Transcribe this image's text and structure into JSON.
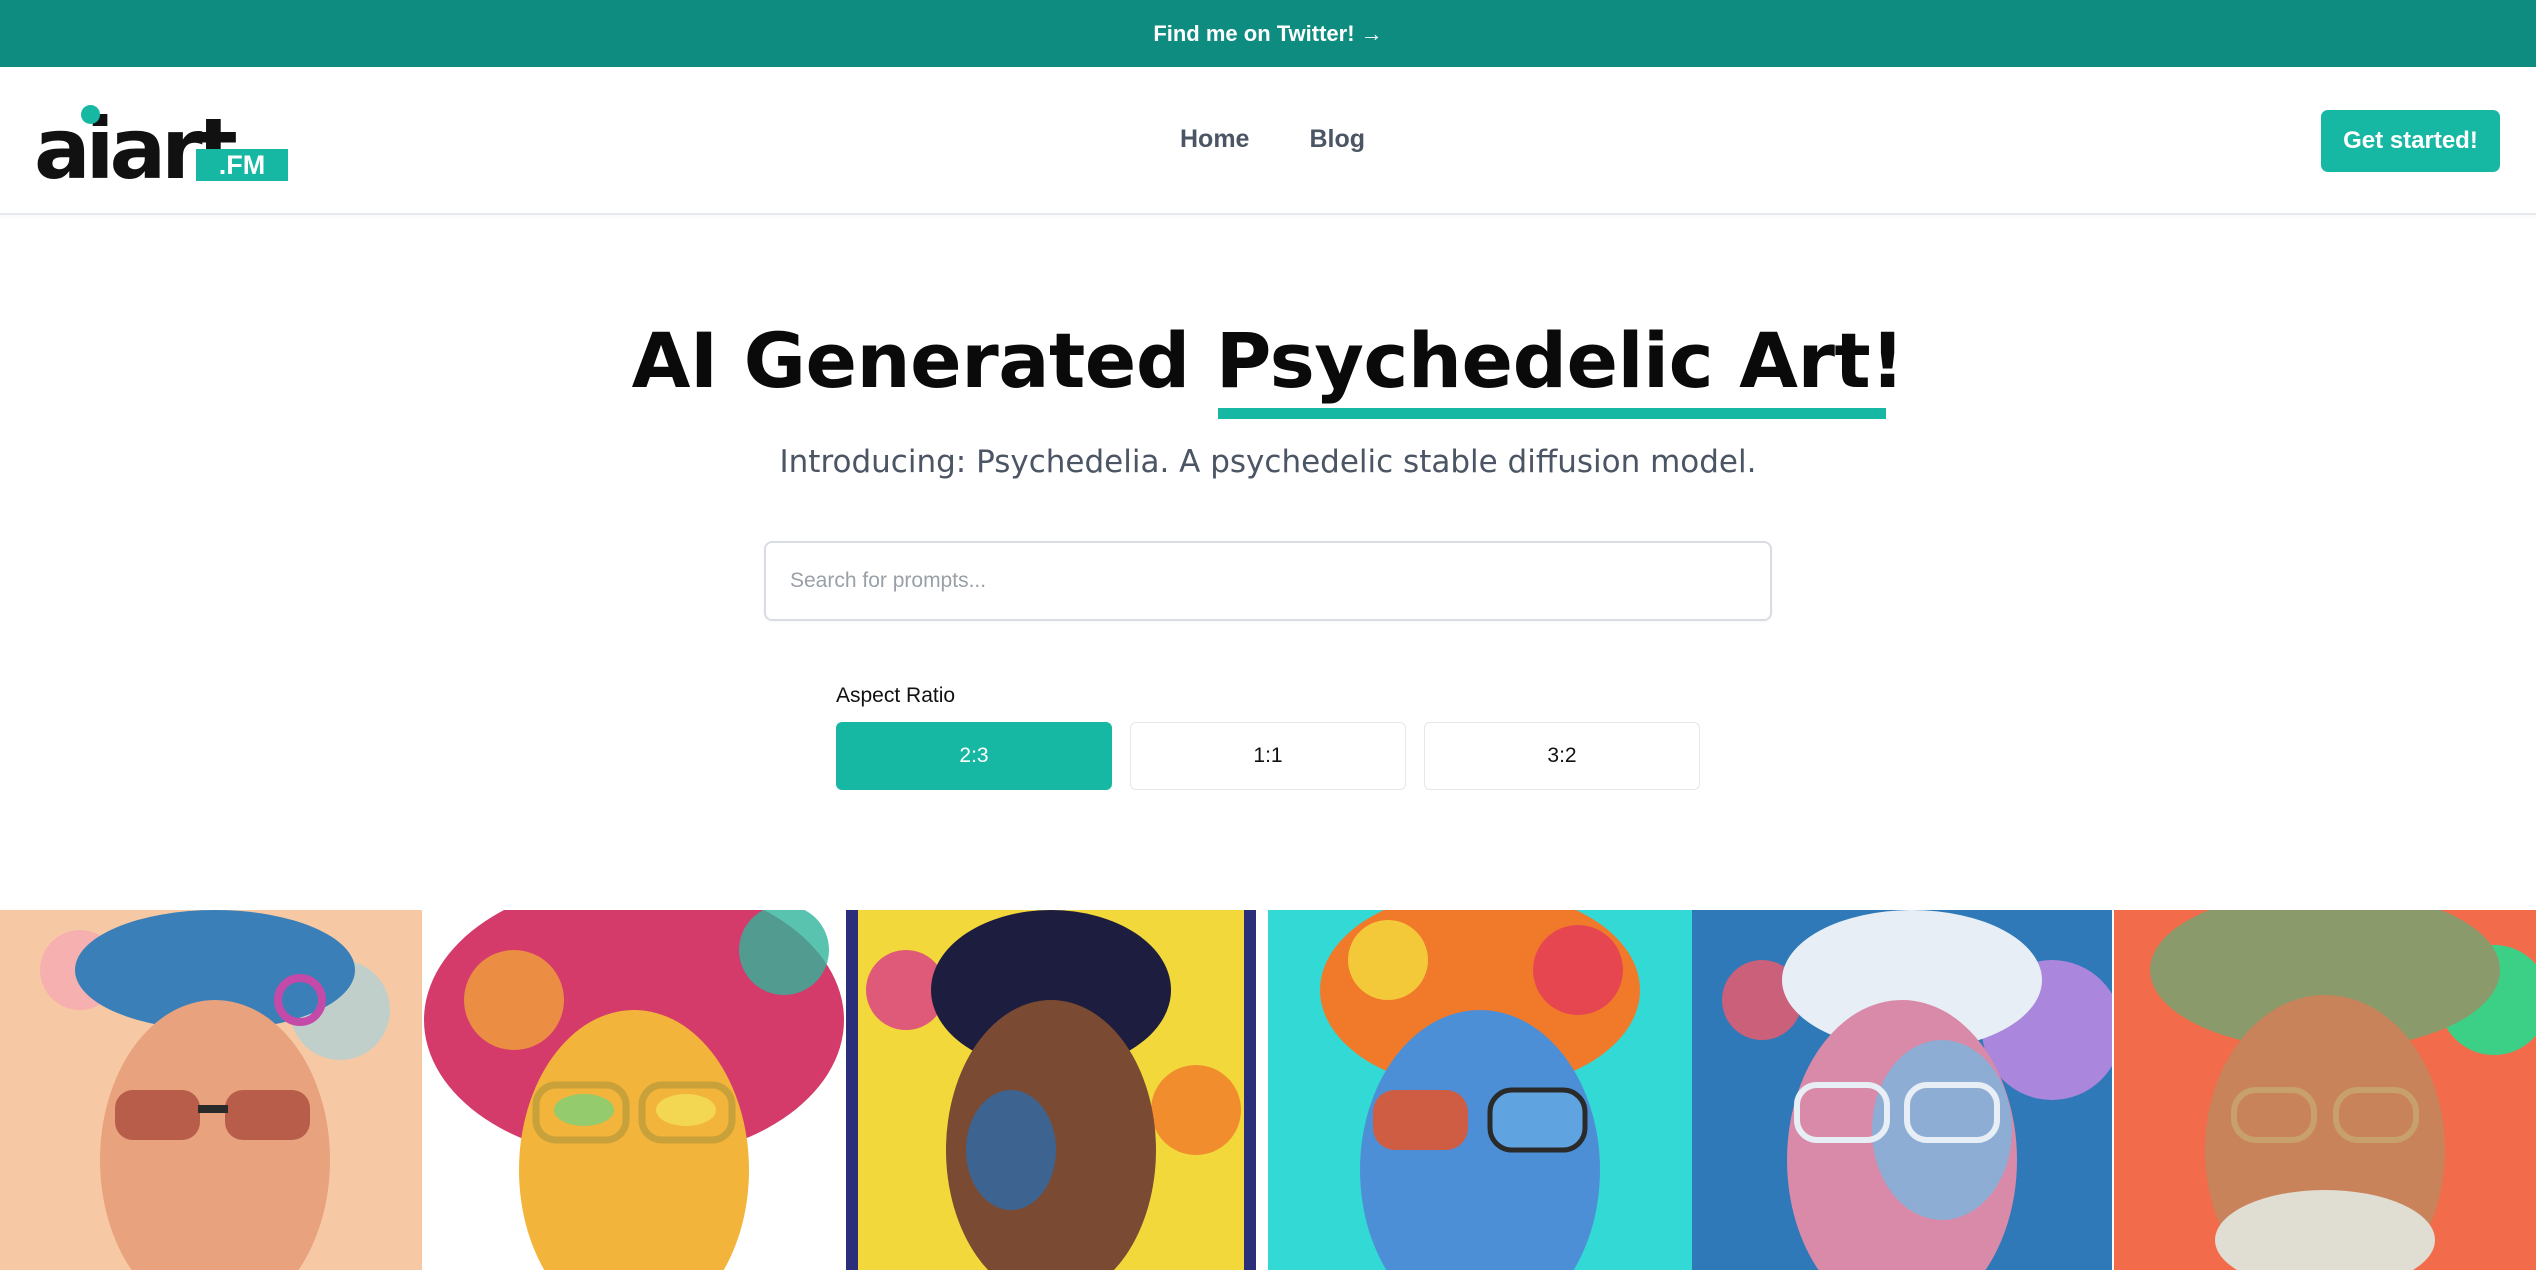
{
  "announcement": {
    "text": "Find me on Twitter! →"
  },
  "logo": {
    "word": "aiart",
    "suffix": ".FM"
  },
  "nav": {
    "links": [
      "Home",
      "Blog"
    ],
    "cta": "Get started!"
  },
  "hero": {
    "title_prefix": "AI Generated ",
    "title_highlight": "Psychedelic Art!",
    "subtitle": "Introducing: Psychedelia. A psychedelic stable diffusion model."
  },
  "search": {
    "placeholder": "Search for prompts..."
  },
  "aspect_ratio": {
    "label": "Aspect Ratio",
    "options": [
      "2:3",
      "1:1",
      "3:2"
    ],
    "selected": "2:3"
  },
  "gallery": {
    "images": [
      {
        "bg": "#f6c9a4",
        "accent": "#3a7fb8",
        "glasses": "#b85d4a"
      },
      {
        "bg": "#d43a6a",
        "accent": "#f3b43b",
        "glasses": "#c9a13a"
      },
      {
        "bg": "#f2d83a",
        "accent": "#2e6aa8",
        "glasses": "#1d1d40"
      },
      {
        "bg": "#33d9d4",
        "accent": "#f07a2a",
        "glasses": "#e6552a"
      },
      {
        "bg": "#2f79b8",
        "accent": "#b887e0",
        "glasses": "#e7eef5"
      },
      {
        "bg": "#f26b4a",
        "accent": "#3cd087",
        "glasses": "#c7a06b"
      }
    ]
  },
  "colors": {
    "brand": "#17b8a3",
    "topbar": "#0f8c80"
  }
}
